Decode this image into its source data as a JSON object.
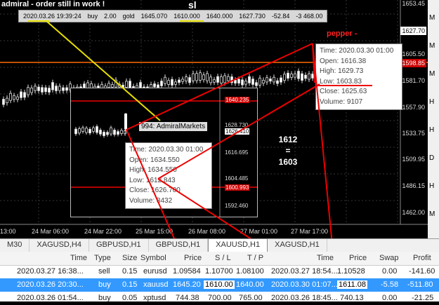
{
  "annotations": {
    "title": "admiral - order still in work !",
    "sl": "sl",
    "pepper": "pepper -",
    "broker": "994: AdmiralMarkets",
    "num_top": "1612",
    "num_eq": "=",
    "num_bottom": "1603"
  },
  "order_bar": {
    "time": "2020.03.26 19:39:24",
    "type": "buy",
    "size": "2.00",
    "symbol": "gold",
    "price": "1645.070",
    "sl": "1610.000",
    "tp": "1640.000",
    "current": "1627.730",
    "swap": "-52.84",
    "profit": "-3 468.00"
  },
  "y_axis": [
    "1653.45",
    "1627.70",
    "1605.50",
    "1581.70",
    "1557.90",
    "1533.75",
    "1509.95",
    "1486.15",
    "1462.00"
  ],
  "price_boxes": {
    "current": "1627.70",
    "red": "1598.85"
  },
  "x_axis": [
    "13:00",
    "24 Mar 06:00",
    "24 Mar 22:00",
    "25 Mar 15:00",
    "26 Mar 08:00",
    "27 Mar 01:00",
    "27 Mar 17:00"
  ],
  "tooltip_main": {
    "time": "Time: 2020.03.30 01:00",
    "open": "Open: 1616.38",
    "high": "High: 1629.73",
    "low": "Low:  1603.83",
    "close": "Close: 1625.63",
    "volume": "Volume: 9107"
  },
  "tooltip_inset": {
    "time": "Time: 2020.03.30 01:00",
    "open": "Open: 1634.550",
    "high": "High: 1634.550",
    "low": "Low:  1612.843",
    "close": "Close: 1626.700",
    "volume": "Volume: 3432"
  },
  "inset_axis": [
    "1640.235",
    "1628.730",
    "1626.410",
    "1616.695",
    "1604.485",
    "1600.993",
    "1592.460"
  ],
  "right_panel": [
    "M",
    "M",
    "M",
    "H",
    "H",
    "D",
    "H",
    "M"
  ],
  "tabs": [
    {
      "label": "M30",
      "active": false
    },
    {
      "label": "XAGUSD,H4",
      "active": false
    },
    {
      "label": "GBPUSD,H1",
      "active": false
    },
    {
      "label": "GBPUSD,H1",
      "active": false
    },
    {
      "label": "XAUUSD,H1",
      "active": true
    },
    {
      "label": "XAGUSD,H1",
      "active": false
    }
  ],
  "table": {
    "headers": [
      "Time",
      "Type",
      "Size",
      "Symbol",
      "Price",
      "S / L",
      "T / P",
      "Time",
      "Price",
      "Swap",
      "Profit"
    ],
    "rows": [
      [
        "2020.03.27 16:38...",
        "sell",
        "0.15",
        "eurusd",
        "1.09584",
        "1.10700",
        "1.08100",
        "2020.03.27 18:54...",
        "1.10528",
        "0.00",
        "-141.60"
      ],
      [
        "2020.03.26 20:30...",
        "buy",
        "0.15",
        "xauusd",
        "1645.20",
        "1610.00",
        "1640.00",
        "2020.03.30 01:07...",
        "1611.08",
        "-5.58",
        "-511.80"
      ],
      [
        "2020.03.26 01:54...",
        "buy",
        "0.05",
        "xptusd",
        "744.38",
        "700.00",
        "765.00",
        "2020.03.26 18:45...",
        "740.13",
        "0.00",
        "-21.25"
      ]
    ]
  }
}
